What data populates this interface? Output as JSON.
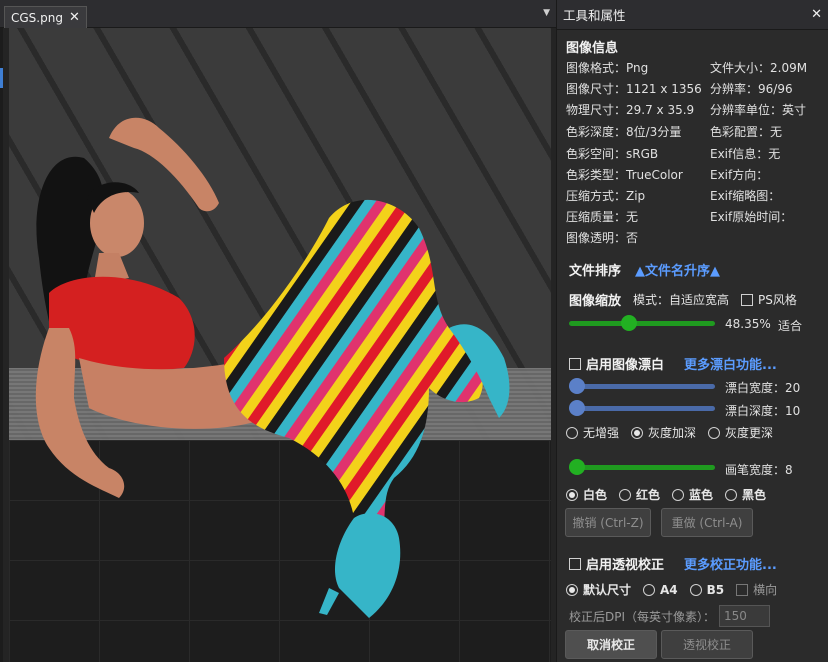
{
  "tab": {
    "label": "CGS.png"
  },
  "panel": {
    "title": "工具和属性"
  },
  "info": {
    "section": "图像信息",
    "left": [
      "图像格式：Png",
      "图像尺寸：1121 x 1356",
      "物理尺寸：29.7 x 35.9",
      "色彩深度：8位/3分量",
      "色彩空间：sRGB",
      "色彩类型：TrueColor",
      "压缩方式：Zip",
      "压缩质量：无",
      "图像透明：否"
    ],
    "right": [
      "文件大小：2.09M",
      "分辨率：96/96",
      "分辨率单位：英寸",
      "色彩配置：无",
      "Exif信息：无",
      "Exif方向：",
      "Exif缩略图：",
      "Exif原始时间："
    ]
  },
  "sort": {
    "label": "文件排序",
    "value": "▲文件名升序▲"
  },
  "zoom": {
    "label": "图像缩放",
    "mode": "模式：自适应宽高",
    "ps_style": "PS风格",
    "value_text": "48.35%",
    "fit_label": "适合",
    "fraction": 0.4
  },
  "whiten": {
    "enable_label": "启用图像漂白",
    "more_label": "更多漂白功能...",
    "width_label": "漂白宽度：20",
    "depth_label": "漂白深度：10",
    "width_fraction": 0.0,
    "depth_fraction": 0.0,
    "enhance_options": [
      "无增强",
      "灰度加深",
      "灰度更深"
    ],
    "enhance_selected": 1,
    "brush_label": "画笔宽度：8",
    "brush_fraction": 0.0,
    "colors": [
      "白色",
      "红色",
      "蓝色",
      "黑色"
    ],
    "color_selected": 0,
    "undo_label": "撤销 (Ctrl-Z)",
    "redo_label": "重做 (Ctrl-A)"
  },
  "perspective": {
    "enable_label": "启用透视校正",
    "more_label": "更多校正功能...",
    "size_options": [
      "默认尺寸",
      "A4",
      "B5"
    ],
    "size_selected": 0,
    "landscape_label": "横向",
    "dpi_label": "校正后DPI（每英寸像素）：",
    "dpi_value": "150",
    "cancel_label": "取消校正",
    "apply_label": "透视校正"
  },
  "colors": {
    "accent_link": "#5b9cff",
    "slider_green": "#1f9a1f",
    "slider_blue": "#4a6aa8",
    "thumb_blue": "#5b80c8"
  }
}
